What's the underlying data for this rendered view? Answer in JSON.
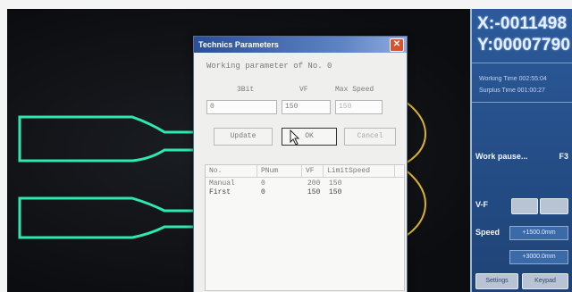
{
  "panel": {
    "coord_x": "X:-0011498",
    "coord_y": "Y:00007790",
    "working_time": "Working Time 002:55:04",
    "surplus_time": "Surplus Time 001:00:27",
    "work_pause_label": "Work pause...",
    "work_pause_key": "F3",
    "vf_label": "V-F",
    "speed_label": "Speed",
    "speed_value": "+1500.0mm",
    "field_value": "+3000.0mm",
    "setting_label": "Settings",
    "extra_button": "Keypad"
  },
  "dialog": {
    "title": "Technics Parameters",
    "heading": "Working parameter of No. 0",
    "labels": {
      "sbit": "3Bit",
      "vf": "VF",
      "max_speed": "Max Speed"
    },
    "values": {
      "sbit": "0",
      "vf": "150",
      "max_speed": "150"
    },
    "buttons": {
      "update": "Update",
      "ok": "OK",
      "cancel": "Cancel"
    },
    "table": {
      "headers": [
        "No.",
        "PNum",
        "VF",
        "LimitSpeed"
      ],
      "rows": [
        [
          "Manual",
          "0",
          "200",
          "150"
        ],
        [
          "First",
          "0",
          "150",
          "150"
        ]
      ]
    }
  },
  "colors": {
    "panel_bg": "#2c5a9a",
    "path_green": "#2ee8b0",
    "curve_gold": "#d8b230",
    "title_blue": "#2a4f9a"
  },
  "icons": [
    "close-icon",
    "mouse-cursor-icon"
  ]
}
